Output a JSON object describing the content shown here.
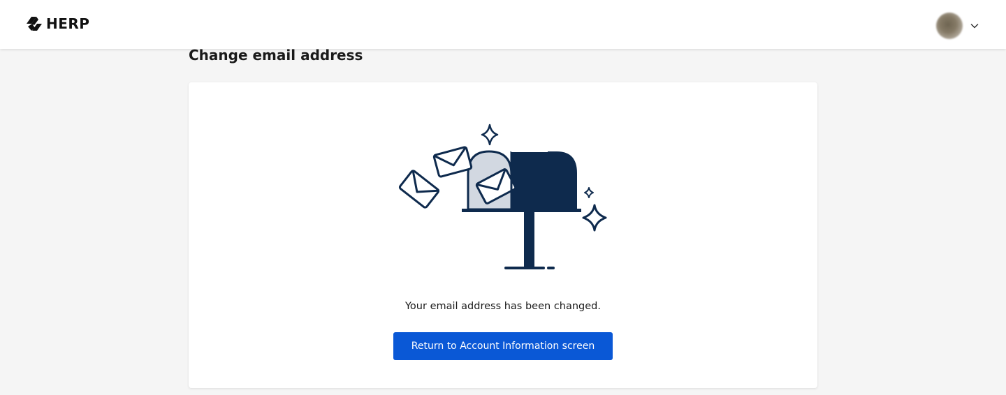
{
  "header": {
    "logo_text": "HERP",
    "user_avatar_icon": "avatar-image",
    "menu_icon": "chevron-down-icon"
  },
  "main": {
    "page_title": "Change email address",
    "illustration_icon": "mailbox-with-letters-illustration",
    "message": "Your email address has been changed.",
    "return_button_label": "Return to Account Information screen"
  },
  "colors": {
    "brand_dark": "#0e2a4d",
    "button_primary": "#0a58d6",
    "background": "#f5f5f5"
  }
}
